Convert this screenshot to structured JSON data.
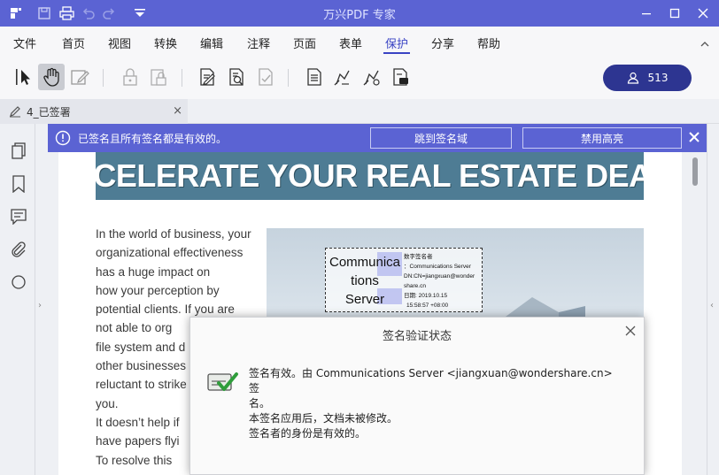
{
  "app": {
    "title": "万兴PDF 专家"
  },
  "colors": {
    "accent": "#5b63d3",
    "user_button": "#2d3591",
    "headline_bg": "#4e7c94"
  },
  "menu": {
    "items": [
      "文件",
      "首页",
      "视图",
      "转换",
      "编辑",
      "注释",
      "页面",
      "表单",
      "保护",
      "分享",
      "帮助"
    ],
    "active": "保护"
  },
  "toolbar": {
    "user_count": "513"
  },
  "document_tab": {
    "label": "4_已签署"
  },
  "banner": {
    "message": "已签名且所有签名都是有效的。",
    "goto_button": "跳到签名域",
    "highlight_button": "禁用高亮"
  },
  "page": {
    "headline": "ACCELERATE YOUR REAL ESTATE DEALS",
    "body_lines": [
      "In the world of business, your",
      "organizational effectiveness",
      "has a huge impact on",
      "how your perception by",
      "potential clients. If you are",
      "not able to org",
      "file system and d",
      "other businesses",
      "reluctant to strike",
      "you.",
      "It doesn’t help if",
      "have papers flyi",
      "To resolve this"
    ],
    "signature": {
      "name_lines": [
        "Communica",
        "tions",
        "Server"
      ],
      "detail_lines": [
        "数字签名者",
        "：Communications Server",
        "DN:CN=jiangxuan@wonder",
        "share.cn",
        "日期: 2019.10.15",
        "15:58:57 +08:00"
      ]
    }
  },
  "dialog": {
    "title": "签名验证状态",
    "lines": [
      "签名有效。由 Communications Server <jiangxuan@wondershare.cn> 签",
      "名。",
      "本签名应用后，文档未被修改。",
      "签名者的身份是有效的。"
    ]
  }
}
